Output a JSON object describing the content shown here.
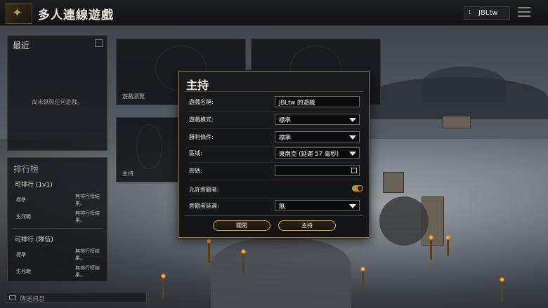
{
  "header": {
    "title": "多人連線遊戲",
    "user_level": "1",
    "username": "JBLtw"
  },
  "recent": {
    "title": "最近",
    "empty_text": "尚未錄製任何遊戲。"
  },
  "leaderboard": {
    "title": "排行榜",
    "sections": [
      {
        "name": "可排行 (1v1)",
        "rows": [
          {
            "mode": "標準",
            "value": "無排行榜結果。"
          },
          {
            "mode": "生死戰",
            "value": "無排行榜結果。"
          }
        ]
      },
      {
        "name": "可排行 (隊伍)",
        "rows": [
          {
            "mode": "標準",
            "value": "無排行榜結果。"
          },
          {
            "mode": "生死戰",
            "value": "無排行榜結果。"
          }
        ]
      }
    ]
  },
  "chat": {
    "placeholder": "傳送訊息"
  },
  "tiles": {
    "browse": "遊戲瀏覽",
    "host": "主持"
  },
  "dialog": {
    "title": "主持",
    "fields": {
      "game_name": {
        "label": "遊戲名稱:",
        "value": "JBLtw 的遊戲"
      },
      "game_mode": {
        "label": "遊戲模式:",
        "value": "標準"
      },
      "victory": {
        "label": "勝利條件:",
        "value": "標準"
      },
      "region": {
        "label": "區域:",
        "value": "東南亞 (延遲 57 毫秒)"
      },
      "password": {
        "label": "密碼:",
        "value": ""
      },
      "allow_spectators": {
        "label": "允許旁觀者:",
        "value": true
      },
      "spectator_delay": {
        "label": "旁觀者延遲:",
        "value": "無"
      }
    },
    "buttons": {
      "close": "關閉",
      "host": "主持"
    }
  },
  "colors": {
    "accent_gold": "#c4a163",
    "toggle_on": "#b7924b"
  }
}
